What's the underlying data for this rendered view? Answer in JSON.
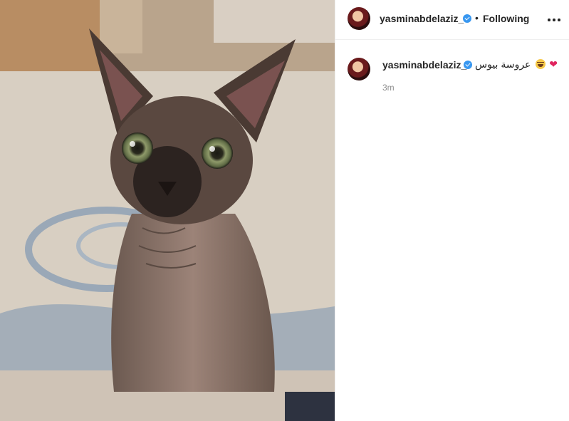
{
  "post": {
    "image_alt": "Sphynx cat sitting on a rug",
    "author": {
      "username": "yasminabdelaziz_",
      "verified": true,
      "follow_state": "Following"
    },
    "caption": {
      "text": "عروسة بيوس",
      "emojis": [
        "laughing-face",
        "red-heart"
      ]
    },
    "timestamp": "3m"
  },
  "colors": {
    "accent_verified": "#3897f0",
    "text_primary": "#262626",
    "text_secondary": "#8e8e8e",
    "heart": "#e0245e"
  }
}
